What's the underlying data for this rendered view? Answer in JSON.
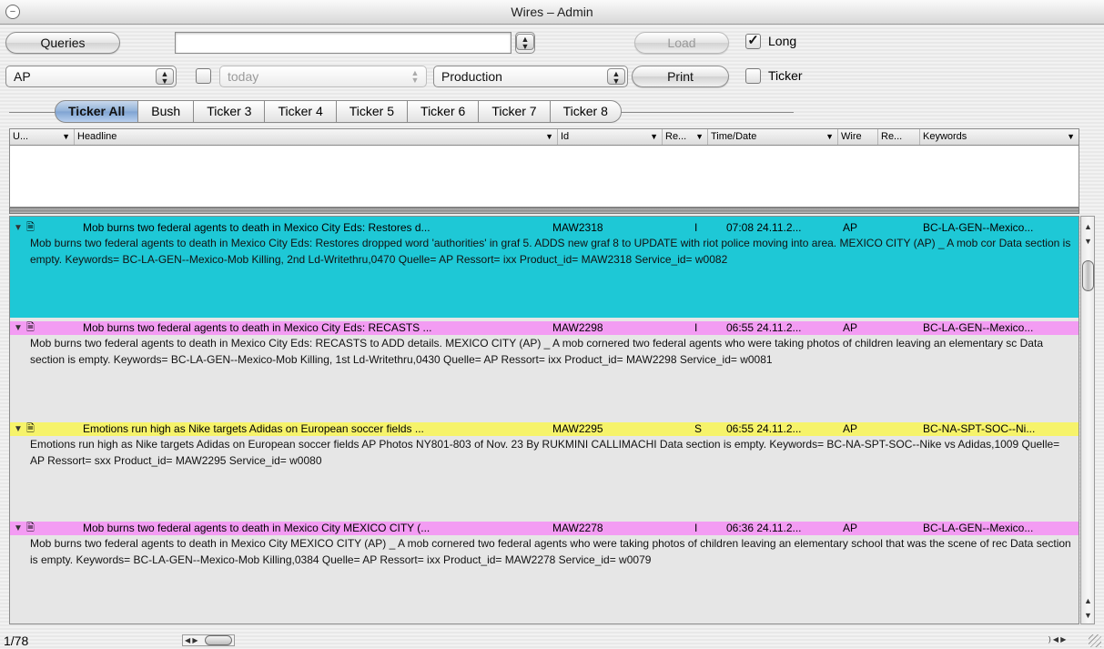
{
  "window": {
    "title": "Wires – Admin"
  },
  "toolbar": {
    "queries_label": "Queries",
    "query_value": "",
    "load_label": "Load",
    "long_label": "Long",
    "long_checked": true,
    "wire_source": "AP",
    "date_value": "today",
    "date_enabled": false,
    "environment": "Production",
    "print_label": "Print",
    "ticker_label": "Ticker",
    "ticker_checked": false
  },
  "tabs": [
    "Ticker All",
    "Bush",
    "Ticker 3",
    "Ticker 4",
    "Ticker 5",
    "Ticker 6",
    "Ticker 7",
    "Ticker 8"
  ],
  "active_tab": "Ticker All",
  "columns": [
    "U...",
    "Headline",
    "Id",
    "Re...",
    "Time/Date",
    "Wire",
    "Re...",
    "Keywords"
  ],
  "entries": [
    {
      "headline": "Mob burns two federal agents to death in Mexico City Eds: Restores d...",
      "id": "MAW2318",
      "re": "I",
      "time": "07:08 24.11.2...",
      "wire": "AP",
      "keywords": "BC-LA-GEN--Mexico...",
      "summary": "Mob burns two federal agents to death in Mexico City Eds: Restores dropped word 'authorities' in graf 5. ADDS new graf 8 to UPDATE with riot police moving into area. MEXICO CITY (AP) _ A mob cor Data section is empty. Keywords= BC-LA-GEN--Mexico-Mob Killing, 2nd Ld-Writethru,0470  Quelle= AP Ressort= ixx Product_id= MAW2318 Service_id= w0082",
      "color": "#1ec8d6",
      "header_color": "#1ec8d6"
    },
    {
      "headline": "Mob burns two federal agents to death in Mexico City Eds: RECASTS ...",
      "id": "MAW2298",
      "re": "I",
      "time": "06:55 24.11.2...",
      "wire": "AP",
      "keywords": "BC-LA-GEN--Mexico...",
      "summary": "Mob burns two federal agents to death in Mexico City Eds: RECASTS to ADD details. MEXICO CITY (AP) _ A mob cornered two federal agents who were taking photos of children leaving an elementary sc Data section is empty. Keywords= BC-LA-GEN--Mexico-Mob Killing, 1st Ld-Writethru,0430  Quelle= AP Ressort= ixx Product_id= MAW2298 Service_id= w0081",
      "color": "#e6e6e6",
      "header_color": "#f39cf3"
    },
    {
      "headline": "Emotions run high as Nike targets Adidas on European soccer fields ...",
      "id": "MAW2295",
      "re": "S",
      "time": "06:55 24.11.2...",
      "wire": "AP",
      "keywords": "BC-NA-SPT-SOC--Ni...",
      "summary": "Emotions run high as Nike targets Adidas on European soccer fields AP Photos NY801-803 of Nov. 23 By RUKMINI CALLIMACHI Data section is empty. Keywords= BC-NA-SPT-SOC--Nike vs Adidas,1009  Quelle= AP Ressort= sxx Product_id= MAW2295 Service_id= w0080",
      "color": "#e6e6e6",
      "header_color": "#f6f36a"
    },
    {
      "headline": "Mob burns two federal agents to death in Mexico City MEXICO CITY (...",
      "id": "MAW2278",
      "re": "I",
      "time": "06:36 24.11.2...",
      "wire": "AP",
      "keywords": "BC-LA-GEN--Mexico...",
      "summary": "Mob burns two federal agents to death in Mexico City MEXICO CITY (AP) _ A mob cornered two federal agents who were taking photos of children leaving an elementary school that was the scene of rec Data section is empty. Keywords= BC-LA-GEN--Mexico-Mob Killing,0384  Quelle= AP Ressort= ixx Product_id= MAW2278 Service_id= w0079",
      "color": "#e6e6e6",
      "header_color": "#f39cf3"
    }
  ],
  "status": {
    "count": "1/78"
  },
  "icons": {
    "disclosure": "disclosure-triangle-icon",
    "document": "document-icon",
    "collapse": "window-collapse-icon"
  }
}
